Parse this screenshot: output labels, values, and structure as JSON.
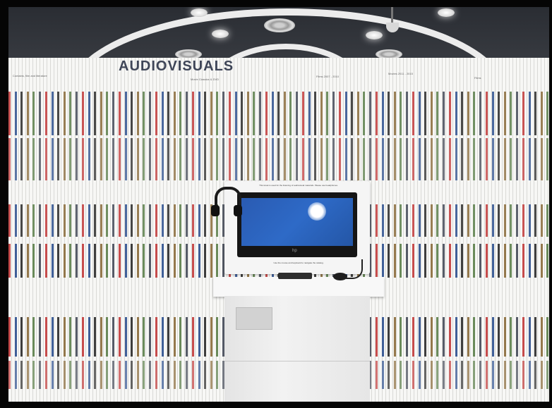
{
  "scene": {
    "sign": {
      "text": "AUDIOVISUALS"
    },
    "shelf_labels": [
      {
        "text": "Contains, film and literature"
      },
      {
        "text": "Movie Classics & DVD"
      },
      {
        "text": "Films 2007 - 2010"
      },
      {
        "text": "Movies 2011 - 2015"
      },
      {
        "text": "Films"
      }
    ],
    "kiosk": {
      "top_note": "This kiosk is used for the listening of audiovisual materials. Please use headphones.",
      "bottom_note": "Use the mouse and keyboard to navigate the catalog.",
      "logo": "hp"
    },
    "colors": {
      "wall": "#f2f2f0",
      "sign_text": "#3f4658",
      "screen": "#2e6ac7",
      "ceiling": "#2a2d33"
    },
    "icons": [
      "headphones-icon",
      "keyboard-icon",
      "mouse-icon",
      "security-camera-icon"
    ]
  }
}
